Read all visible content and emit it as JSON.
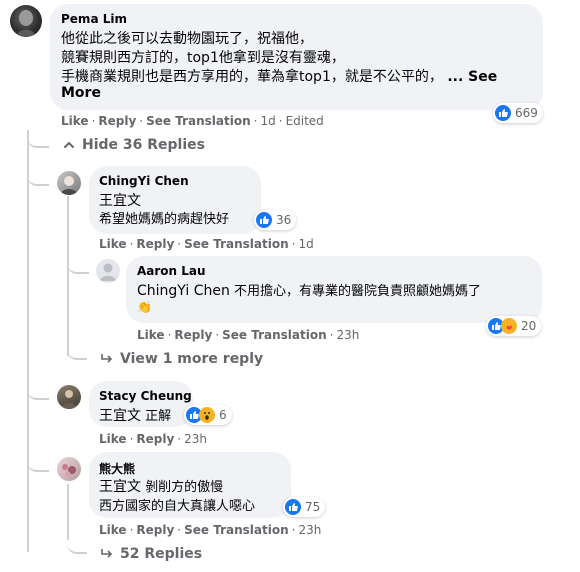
{
  "comments": {
    "pema": {
      "author": "Pema Lim",
      "lines": [
        "他從此之後可以去動物園玩了，祝福他，",
        "競賽規則西方訂的，top1他拿到是沒有靈魂，",
        "手機商業規則也是西方享用的，華為拿top1，就是不公平的，"
      ],
      "see_more_1": "... See",
      "see_more_2": "More",
      "like": "Like",
      "reply": "Reply",
      "translate": "See Translation",
      "time": "1d",
      "edited": "Edited",
      "reaction_count": "669"
    },
    "hide_replies": "Hide 36 Replies",
    "chingyi": {
      "author": "ChingYi Chen",
      "line1": "王宜文",
      "line2": "希望她媽媽的病趕快好",
      "like": "Like",
      "reply": "Reply",
      "translate": "See Translation",
      "time": "1d",
      "reaction_count": "36"
    },
    "aaron": {
      "author": "Aaron Lau",
      "mention": "ChingYi Chen",
      "text": " 不用擔心，有專業的醫院負責照顧她媽媽了",
      "emoji": "👏",
      "like": "Like",
      "reply": "Reply",
      "translate": "See Translation",
      "time": "23h",
      "reaction_count": "20"
    },
    "view_more": "View 1 more reply",
    "stacy": {
      "author": "Stacy Cheung",
      "mention": "王宜文",
      "text": " 正解",
      "like": "Like",
      "reply": "Reply",
      "time": "23h",
      "reaction_count": "6"
    },
    "bear": {
      "author": "熊大熊",
      "mention": "王宜文",
      "text1": " 剝削方的傲慢",
      "line2": "西方國家的自大真讓人噁心",
      "like": "Like",
      "reply": "Reply",
      "translate": "See Translation",
      "time": "23h",
      "reaction_count": "75"
    },
    "replies_52": "52 Replies"
  },
  "colors": {
    "bubble": "#f0f2f5",
    "meta": "#65676b",
    "like_blue": "#1877f2",
    "thread": "#ced0d4"
  }
}
